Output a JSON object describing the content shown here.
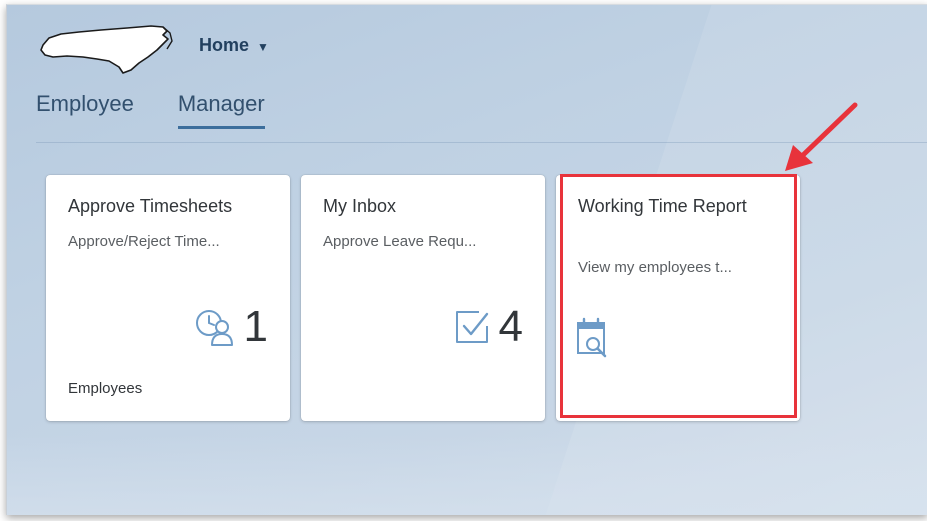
{
  "header": {
    "logo_icon": "north-carolina-state-icon",
    "home_label": "Home",
    "home_caret": "▼"
  },
  "tabs": [
    {
      "label": "Employee",
      "active": false
    },
    {
      "label": "Manager",
      "active": true
    }
  ],
  "tiles": [
    {
      "title": "Approve Timesheets",
      "subtitle": "Approve/Reject Time...",
      "icon": "timesheet-person-clock-icon",
      "kpi_value": "1",
      "footer": "Employees"
    },
    {
      "title": "My Inbox",
      "subtitle": "Approve Leave Requ...",
      "icon": "inbox-checkmark-icon",
      "kpi_value": "4",
      "footer": ""
    },
    {
      "title": "Working Time Report",
      "subtitle": "View my employees t...",
      "icon": "calendar-search-icon",
      "highlighted": true
    }
  ],
  "annotation": {
    "highlight_color": "#e8333b",
    "arrow_color": "#e8333b"
  },
  "colors": {
    "accent": "#3c6e9c",
    "icon": "#6d9bc7",
    "text_dark": "#32363a"
  }
}
